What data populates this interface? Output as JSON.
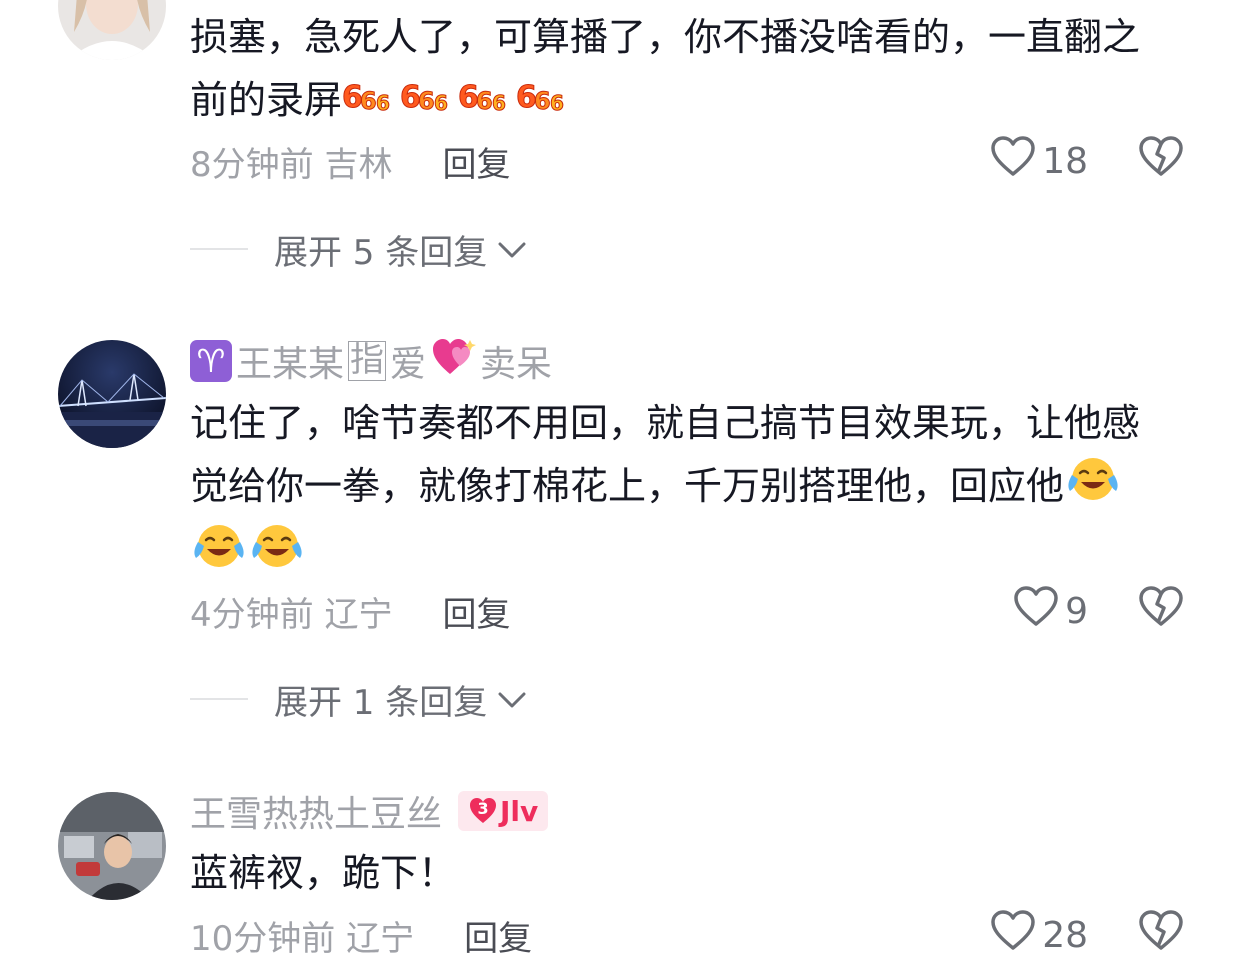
{
  "comments": [
    {
      "username": "",
      "text": "损塞，急死人了，可算播了，你不播没啥看的，一直翻之前的录屏",
      "time_location": "8分钟前 吉林",
      "reply_label": "回复",
      "likes": "18",
      "emojis": [
        "666-icon",
        "666-icon",
        "666-icon",
        "666-icon"
      ],
      "expand_label": "展开 5 条回复"
    },
    {
      "username_prefix_icon": "aries-icon",
      "username_part1": "王某某",
      "username_boxed": "指",
      "username_part2": "爱",
      "username_heart_icon": "sparkling-heart-icon",
      "username_part3": "卖呆",
      "text": "记住了，啥节奏都不用回，就自己搞节目效果玩，让他感觉给你一拳，就像打棉花上，千万别搭理他，回应他",
      "time_location": "4分钟前 辽宁",
      "reply_label": "回复",
      "likes": "9",
      "emojis": [
        "laugh-cry-icon",
        "laugh-cry-icon",
        "laugh-cry-icon"
      ],
      "expand_label": "展开 1 条回复"
    },
    {
      "username": "王雪热热土豆丝",
      "level_num": "3",
      "level_text": "Jlv",
      "text": "蓝裤衩，跪下！",
      "time_location": "10分钟前 辽宁",
      "reply_label": "回复",
      "likes": "28"
    }
  ],
  "colors": {
    "text_primary": "#161823",
    "text_secondary": "#a0a2a8",
    "reply": "#4a4c54",
    "badge_pink": "#ee2d5c",
    "aries_purple": "#8e5fd6"
  }
}
